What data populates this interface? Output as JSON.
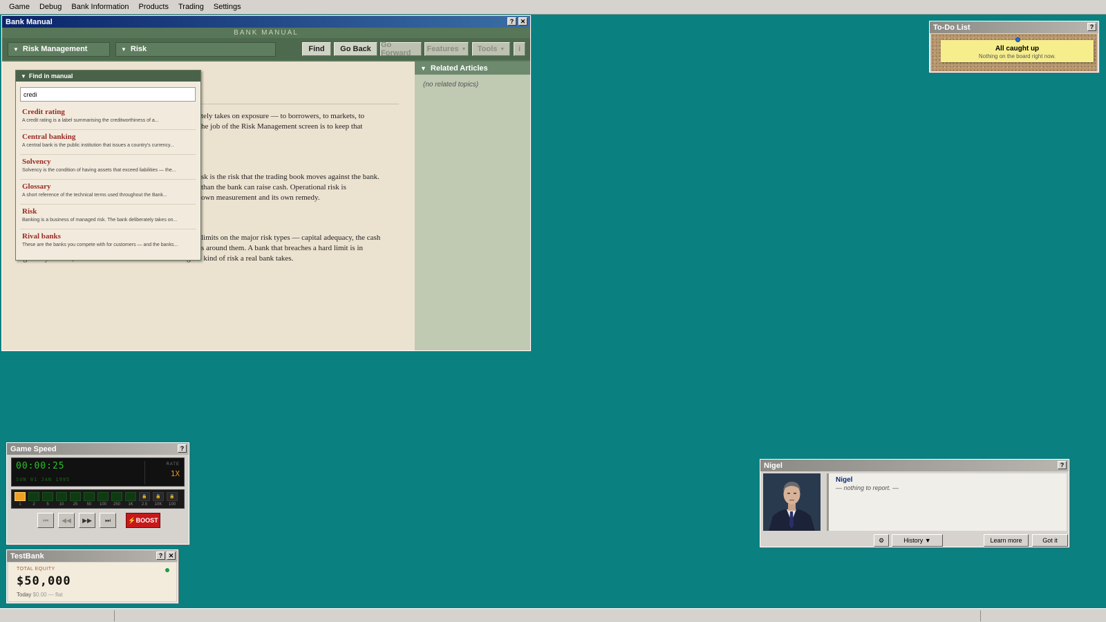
{
  "menu": [
    "Game",
    "Debug",
    "Bank Information",
    "Products",
    "Trading",
    "Settings"
  ],
  "bank_manual": {
    "title": "Bank Manual",
    "header": "BANK MANUAL",
    "dropdown_category": "Risk Management",
    "dropdown_topic": "Risk",
    "buttons": {
      "find": "Find",
      "go_back": "Go Back",
      "go_forward": "Go Forward",
      "features": "Features",
      "tools": "Tools",
      "info": "i"
    },
    "body_lines": [
      "tely takes on exposure — to borrowers, to markets, to",
      "he job of the Risk Management screen is to keep that",
      "sk is the risk that the trading book moves against the bank.",
      " than the bank can raise cash. Operational risk is",
      " own measurement and its own remedy.",
      "limits on the major risk types — capital adequacy, the cash",
      "s around them. A bank that breaches a hard limit is in",
      "regulatory trouble; a bank that runs close to one is taking the kind of risk a real bank takes."
    ],
    "related": {
      "heading": "Related Articles",
      "empty": "(no related topics)"
    }
  },
  "find_panel": {
    "heading": "Find in manual",
    "query": "credi",
    "results": [
      {
        "title": "Credit rating",
        "desc": "A credit rating is a label summarising the creditworthiness of a..."
      },
      {
        "title": "Central banking",
        "desc": "A central bank is the public institution that issues a country's currency..."
      },
      {
        "title": "Solvency",
        "desc": "Solvency is the condition of having assets that exceed liabilities — the..."
      },
      {
        "title": "Glossary",
        "desc": "A short reference of the technical terms used throughout the Bank..."
      },
      {
        "title": "Risk",
        "desc": "Banking is a business of managed risk. The bank deliberately takes on..."
      },
      {
        "title": "Rival banks",
        "desc": "These are the banks you compete with for customers — and the banks..."
      }
    ]
  },
  "todo": {
    "title": "To-Do List",
    "note_heading": "All caught up",
    "note_sub": "Nothing on the board right now."
  },
  "game_speed": {
    "title": "Game Speed",
    "time": "00:00:25",
    "date": "SUN 01 JAN 1995",
    "rate_label": "RATE",
    "rate_value": "1X",
    "speeds": [
      "1",
      "2",
      "5",
      "10",
      "25",
      "50",
      "100",
      "250",
      "1K",
      "2.5",
      "10K",
      "100"
    ],
    "active_speed_index": 0,
    "locked_from_index": 9,
    "boost": "⚡BOOST"
  },
  "testbank": {
    "title": "TestBank",
    "label": "TOTAL EQUITY",
    "value": "$50,000",
    "footer_today": "Today",
    "footer_change": "$0.00 — flat"
  },
  "nigel": {
    "title": "Nigel",
    "name": "Nigel",
    "message": "— nothing to report. —",
    "history": "History ▼",
    "learn_more": "Learn more",
    "got_it": "Got it"
  }
}
